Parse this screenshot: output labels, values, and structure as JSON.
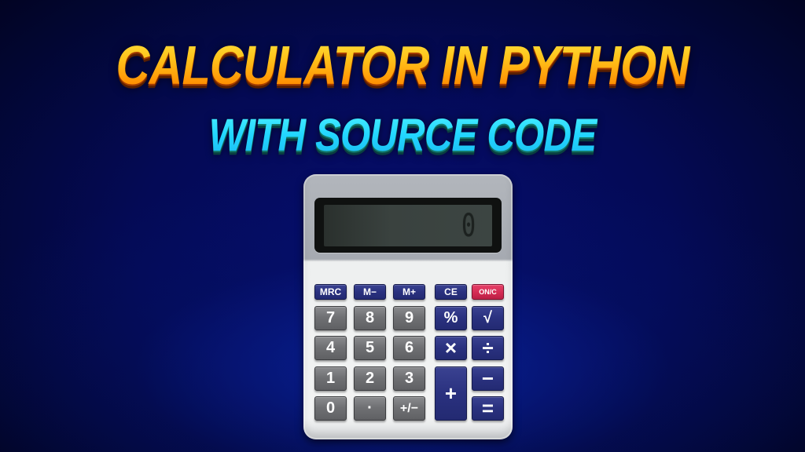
{
  "title": {
    "line1": "CALCULATOR IN PYTHON",
    "line2": "WITH SOURCE CODE",
    "line1_color": "#ffb300",
    "line2_color": "#22d6ff"
  },
  "calculator": {
    "display_value": "0",
    "memory_keys": [
      {
        "label": "MRC",
        "name": "memory-recall-clear-key"
      },
      {
        "label": "M−",
        "name": "memory-minus-key"
      },
      {
        "label": "M+",
        "name": "memory-plus-key"
      },
      {
        "label": "CE",
        "name": "clear-entry-key"
      },
      {
        "label": "ON/C",
        "name": "on-clear-key"
      }
    ],
    "digit_keys": [
      "7",
      "8",
      "9",
      "4",
      "5",
      "6",
      "1",
      "2",
      "3",
      "0",
      "·",
      "+/−"
    ],
    "operator_keys": {
      "percent": "%",
      "sqrt": "√",
      "multiply": "×",
      "divide": "÷",
      "add": "+",
      "subtract": "−",
      "equals": "="
    },
    "colors": {
      "digit_key": "#707174",
      "function_key": "#2a317f",
      "on_key": "#d22a52",
      "body": "#f2f3f3",
      "lcd": "#3a423f"
    }
  }
}
